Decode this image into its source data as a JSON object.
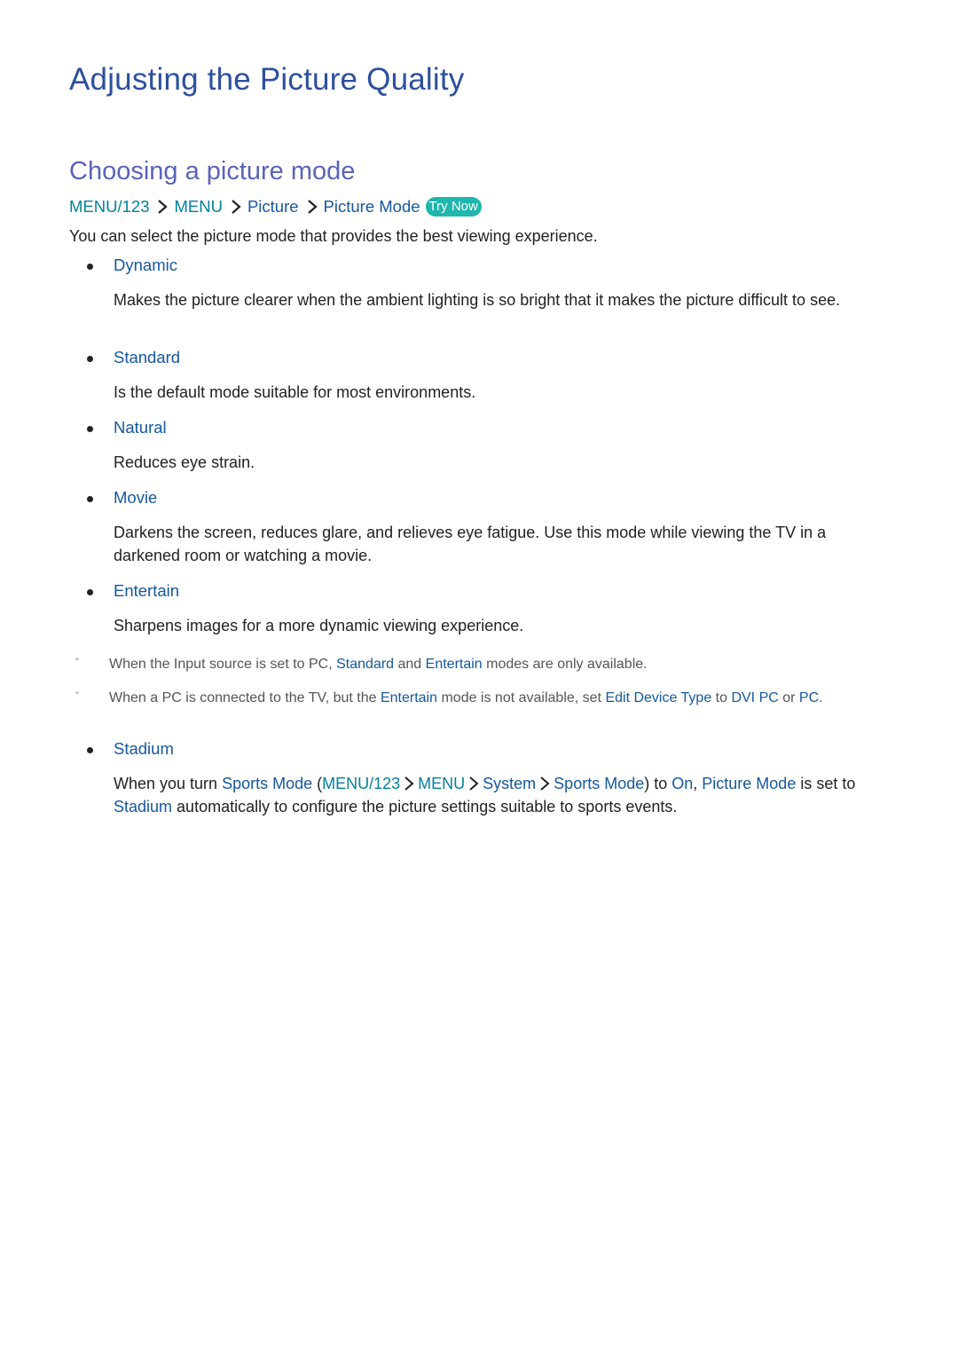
{
  "page_title": "Adjusting the Picture Quality",
  "section_title": "Choosing a picture mode",
  "breadcrumb": {
    "items": [
      "MENU/123",
      "MENU",
      "Picture",
      "Picture Mode"
    ],
    "separator_icon": "chevron-right-icon",
    "try_now_label": "Try Now"
  },
  "intro": "You can select the picture mode that provides the best viewing experience.",
  "modes": [
    {
      "name": "Dynamic",
      "description": "Makes the picture clearer when the ambient lighting is so bright that it makes the picture difficult to see."
    },
    {
      "name": "Standard",
      "description": "Is the default mode suitable for most environments."
    },
    {
      "name": "Natural",
      "description": "Reduces eye strain."
    },
    {
      "name": "Movie",
      "description": "Darkens the screen, reduces glare, and relieves eye fatigue. Use this mode while viewing the TV in a darkened room or watching a movie."
    },
    {
      "name": "Entertain",
      "description": "Sharpens images for a more dynamic viewing experience."
    }
  ],
  "notes": [
    {
      "mark": "\"",
      "parts": [
        "When the Input source is set to PC, ",
        "Standard",
        " and ",
        "Entertain",
        " modes are only available."
      ]
    },
    {
      "mark": "\"",
      "parts": [
        "When a PC is connected to the TV, but the ",
        "Entertain",
        " mode is not available, set ",
        "Edit Device Type",
        " to ",
        "DVI PC",
        " or ",
        "PC",
        "."
      ]
    }
  ],
  "stadium": {
    "name": "Stadium",
    "parts": {
      "p1": "When you turn ",
      "sports_mode": "Sports Mode",
      "p2": " (",
      "path": [
        "MENU/123",
        "MENU",
        "System",
        "Sports Mode"
      ],
      "p3": ") to ",
      "on": "On",
      "p4": ", ",
      "picture_mode": "Picture Mode",
      "p5": " is set to ",
      "stadium": "Stadium",
      "p6": " automatically to configure the picture settings suitable to sports events."
    }
  },
  "colors": {
    "title": "#2d4f9e",
    "subtitle": "#5b63b8",
    "menu_teal": "#00829c",
    "link_blue": "#1558a0",
    "try_now_bg": "#1fb7ad"
  }
}
